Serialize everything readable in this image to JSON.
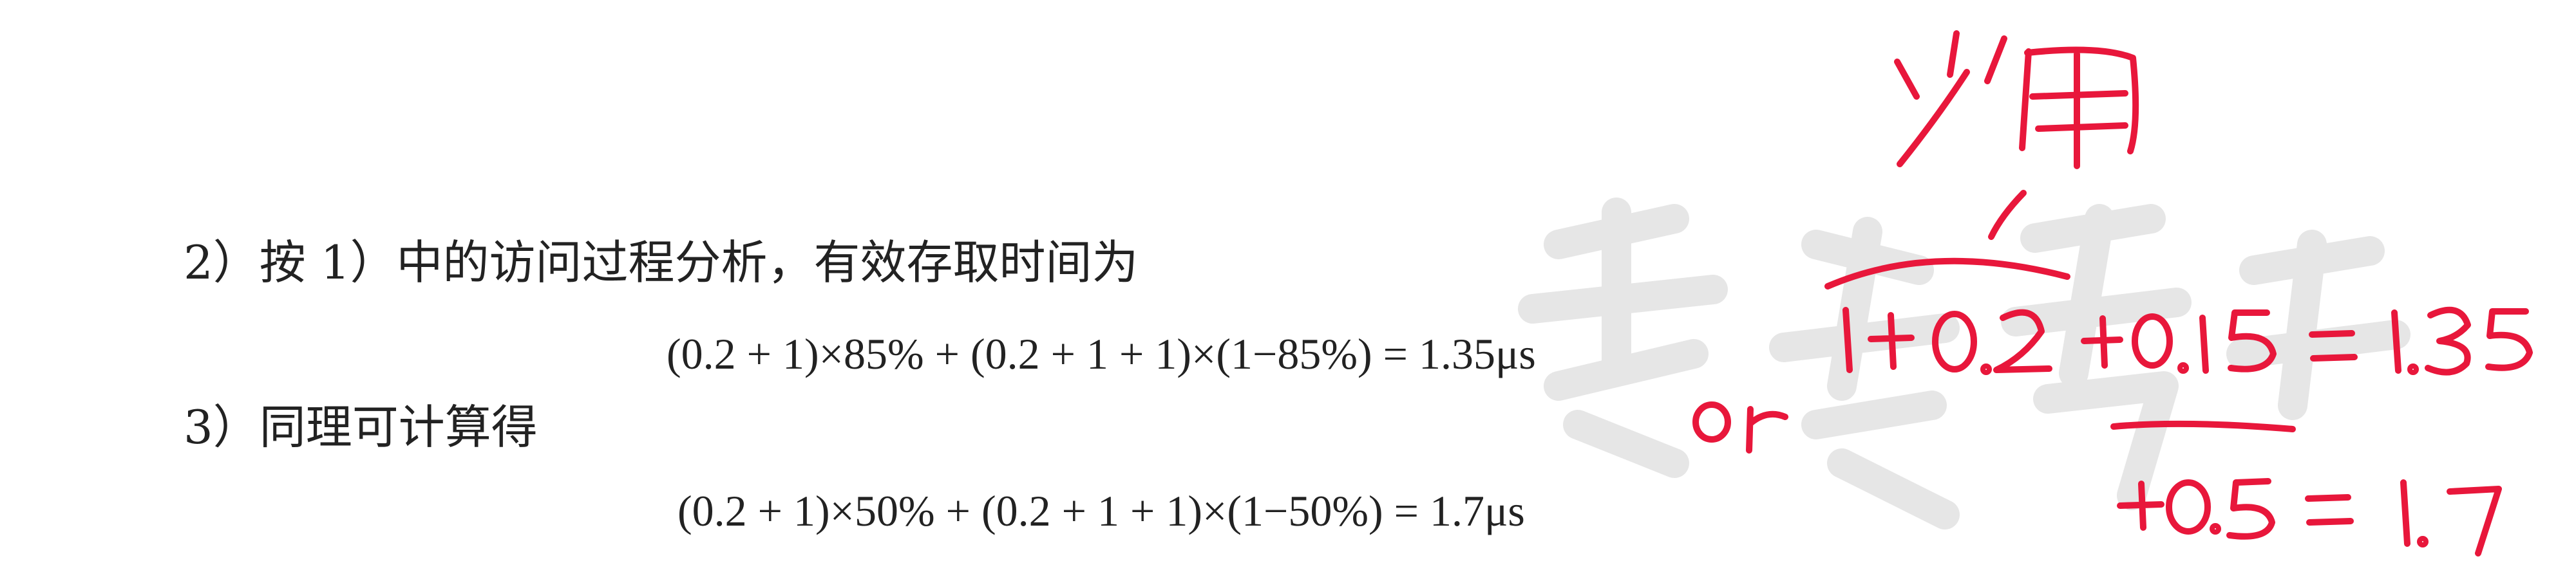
{
  "document": {
    "line_2": "2）按 1）中的访问过程分析，有效存取时间为",
    "formula_1": "(0.2 + 1)×85% + (0.2 + 1 + 1)×(1−85%) = 1.35μs",
    "line_3": "3）同理可计算得",
    "formula_2": "(0.2 + 1)×50% + (0.2 + 1 + 1)×(1−50%) = 1.7μs"
  },
  "handwritten_notes": {
    "heading": "少用",
    "eq_1": "1+0.2+0.15=1.35",
    "connector": "or",
    "eq_2": "+0.5=1.7"
  },
  "colors": {
    "text": "#222222",
    "ink": "#e8173b",
    "watermark": "#e6e6e6"
  }
}
